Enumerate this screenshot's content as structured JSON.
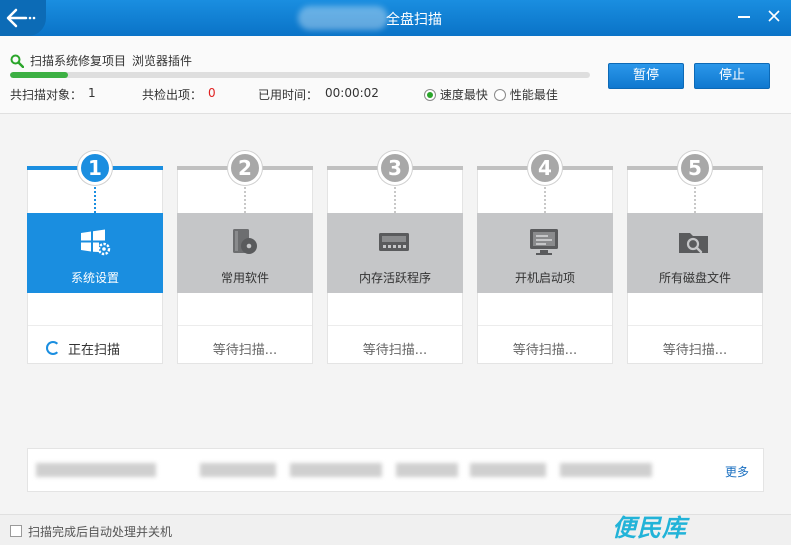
{
  "window": {
    "title": "全盘扫描"
  },
  "scan": {
    "scanning_text": "扫描系统修复项目",
    "current_item": "浏览器插件",
    "progress": 0.1,
    "objects_label": "共扫描对象：",
    "objects_value": "1",
    "issues_label": "共检出项：",
    "issues_value": "0",
    "time_label": "已用时间：",
    "time_value": "00:00:02",
    "mode_fast": "速度最快",
    "mode_perf": "性能最佳",
    "selected_mode": "fast"
  },
  "buttons": {
    "pause": "暂停",
    "stop": "停止"
  },
  "steps": [
    {
      "number": "1",
      "label": "系统设置",
      "status": "正在扫描",
      "icon": "windows-gear-icon",
      "active": true
    },
    {
      "number": "2",
      "label": "常用软件",
      "status": "等待扫描...",
      "icon": "software-disc-icon",
      "active": false
    },
    {
      "number": "3",
      "label": "内存活跃程序",
      "status": "等待扫描...",
      "icon": "memory-chip-icon",
      "active": false
    },
    {
      "number": "4",
      "label": "开机启动项",
      "status": "等待扫描...",
      "icon": "monitor-startup-icon",
      "active": false
    },
    {
      "number": "5",
      "label": "所有磁盘文件",
      "status": "等待扫描...",
      "icon": "folder-search-icon",
      "active": false
    }
  ],
  "log": {
    "more": "更多"
  },
  "footer": {
    "auto_shutdown": "扫描完成后自动处理并关机",
    "auto_shutdown_checked": false
  },
  "watermark": "便民库",
  "colors": {
    "accent": "#1a8ee0",
    "progress": "#3cb043",
    "issue_count": "#e02020",
    "inactive_tile": "#c5c6c8"
  }
}
